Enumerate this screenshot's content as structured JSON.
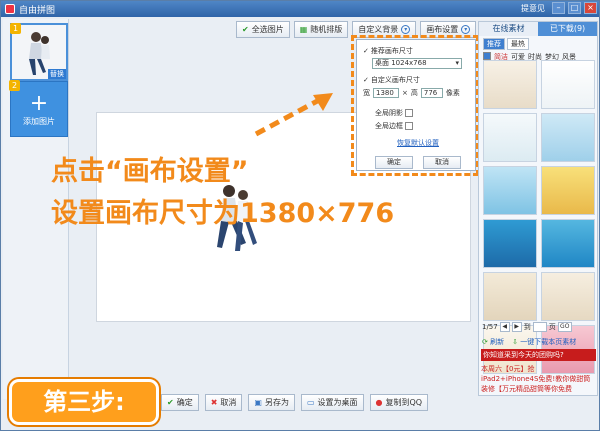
{
  "window": {
    "title": "自由拼图",
    "feedback": "提意见"
  },
  "left": {
    "badge1": "1",
    "replace_label": "替换",
    "badge2": "2",
    "add_label": "添加图片"
  },
  "toolbar": {
    "select_all": "全选图片",
    "random": "随机排版",
    "custom_bg": "自定义背景",
    "canvas_settings": "画布设置"
  },
  "popup": {
    "recommend_label": "推荐画布尺寸",
    "size_option": "桌面  1024x768",
    "custom_label": "自定义画布尺寸",
    "width_label": "宽",
    "width_value": "1380",
    "height_label": "高",
    "height_value": "776",
    "unit": "像素",
    "shadow_label": "全局阴影",
    "border_label": "全局边框",
    "restore_link": "恢复默认设置",
    "ok": "确定",
    "cancel": "取消"
  },
  "instruction": {
    "line1": "点击“画布设置”",
    "line2": "设置画布尺寸为1380×776"
  },
  "right": {
    "tab_online": "在线素材",
    "tab_downloaded": "已下载(9)",
    "sub_recommend": "推荐",
    "sub_latest": "最热",
    "categories": [
      "简洁",
      "可爱",
      "时尚",
      "梦幻",
      "风景"
    ],
    "page_indicator": "1/57",
    "goto_label": "到",
    "page_unit": "页",
    "go_label": "GO",
    "refresh": "刷新",
    "download_all": "一键下载本页素材",
    "promo_banner": "你知道采到今天的团购吗?",
    "promo_line1": "本周六【0元】抢",
    "promo_line2": "iPad2+iPhone4S免费!教你做甜筒",
    "promo_line3": "装修【万元精品甜筒等你免费"
  },
  "bottom": {
    "ok": "确定",
    "cancel": "取消",
    "save_as": "另存为",
    "set_desktop": "设置为桌面",
    "copy_qq": "复制到QQ"
  },
  "step_label": "第三步:",
  "colors": {
    "accent": "#f28a1b",
    "title_blue": "#2f64a8",
    "promo_red": "#c71c1c"
  }
}
